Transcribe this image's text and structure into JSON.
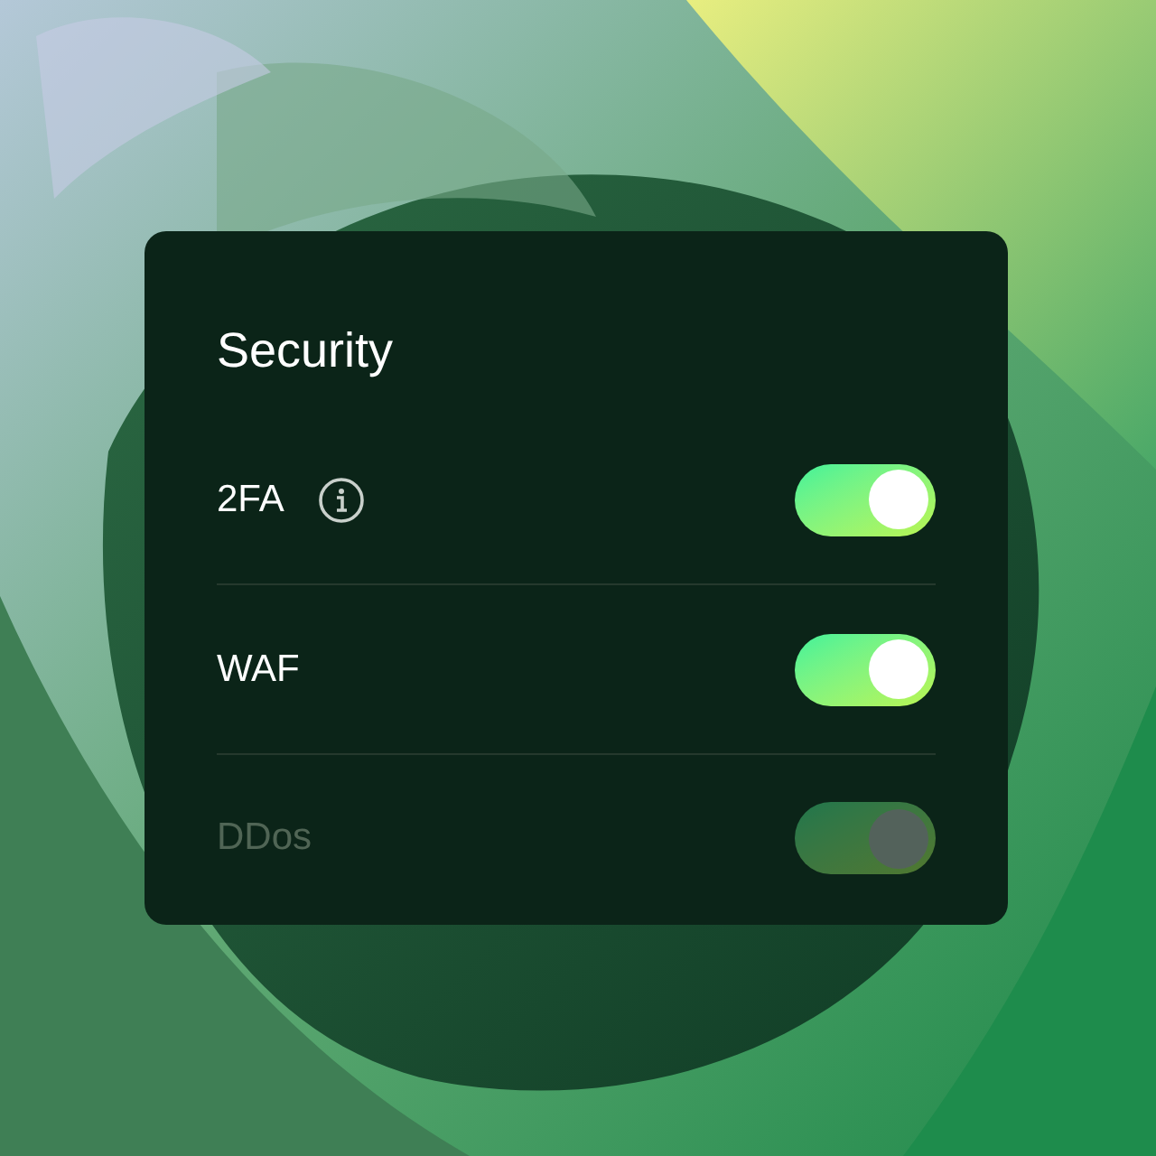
{
  "title": "Security",
  "rows": [
    {
      "label": "2FA",
      "info": true,
      "checked": true,
      "disabled": false
    },
    {
      "label": "WAF",
      "info": false,
      "checked": true,
      "disabled": false
    },
    {
      "label": "DDos",
      "info": false,
      "checked": true,
      "disabled": true
    }
  ]
}
